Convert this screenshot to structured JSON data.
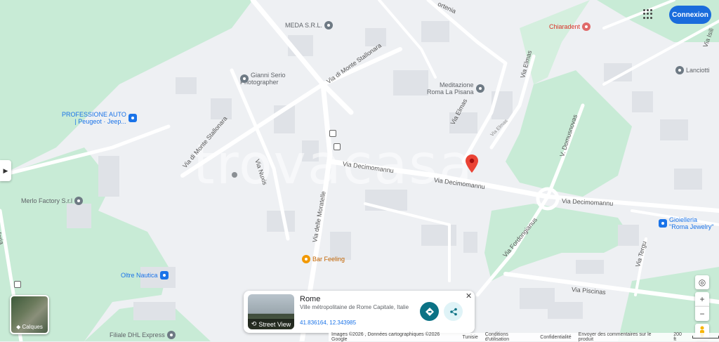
{
  "colors": {
    "park": "#c8ebd6",
    "road": "#ffffff",
    "block": "#dfe2e7",
    "accent": "#1a6cdc",
    "pin": "#ea4335"
  },
  "header": {
    "connexion_label": "Connexion",
    "apps_icon": "apps-grid-icon"
  },
  "watermark": "trovacasa",
  "roads": {
    "monte_stallonara_n": "Via di Monte Stallonara",
    "monte_stallonara_w": "Via di Monte Stallonara",
    "elmas_1": "Via Elmas",
    "elmas_2": "Via Elmas",
    "elmas_3": "Via Elmas",
    "nuxis": "Via Nuxis",
    "moratelle": "Via delle Moratelle",
    "decimomannu_1": "Via Decimomannu",
    "decimomannu_2": "Via Decimomannu",
    "decimomannu_3": "Via Decimomannu",
    "domusnovas": "V. Domusnovas",
    "fordongianus": "Via Fordongianus",
    "tergu": "Via Tergu",
    "piscinas": "Via Piscinas",
    "isili": "Via Isili",
    "ortenia": "ortenia",
    "feria": "feria"
  },
  "pois": {
    "meda": "MEDA S.R.L.",
    "chiaradent": "Chiaradent",
    "gianni_1": "Gianni Serio",
    "gianni_2": "Photographer",
    "meditazione_1": "Meditazione",
    "meditazione_2": "Roma La Pisana",
    "professione_1": "PROFESSIONE AUTO",
    "professione_2": "| Peugeot · Jeep...",
    "lanciotti": "Lanciotti",
    "merlo": "Merlo Factory S.r.l",
    "gioielleria_1": "Gioielleria",
    "gioielleria_2": "\"Roma Jewelry\"",
    "bar_feeling": "Bar Feeling",
    "oltre_nautica": "Oltre Nautica",
    "dhl": "Filiale DHL Express"
  },
  "card": {
    "title": "Rome",
    "subtitle": "Ville métropolitaine de Rome Capitale, Italie",
    "coords": "41.836164, 12.343985",
    "street_view_label": "Street View"
  },
  "layers_label": "Calques",
  "footer": {
    "images": "Images ©2026 , Données cartographiques ©2026 Google",
    "country": "Tunisie",
    "terms": "Conditions d'utilisation",
    "privacy": "Confidentialité",
    "feedback": "Envoyer des commentaires sur le produit",
    "scale": "200 ft"
  },
  "map_controls": {
    "zoom_in": "+",
    "zoom_out": "−"
  }
}
